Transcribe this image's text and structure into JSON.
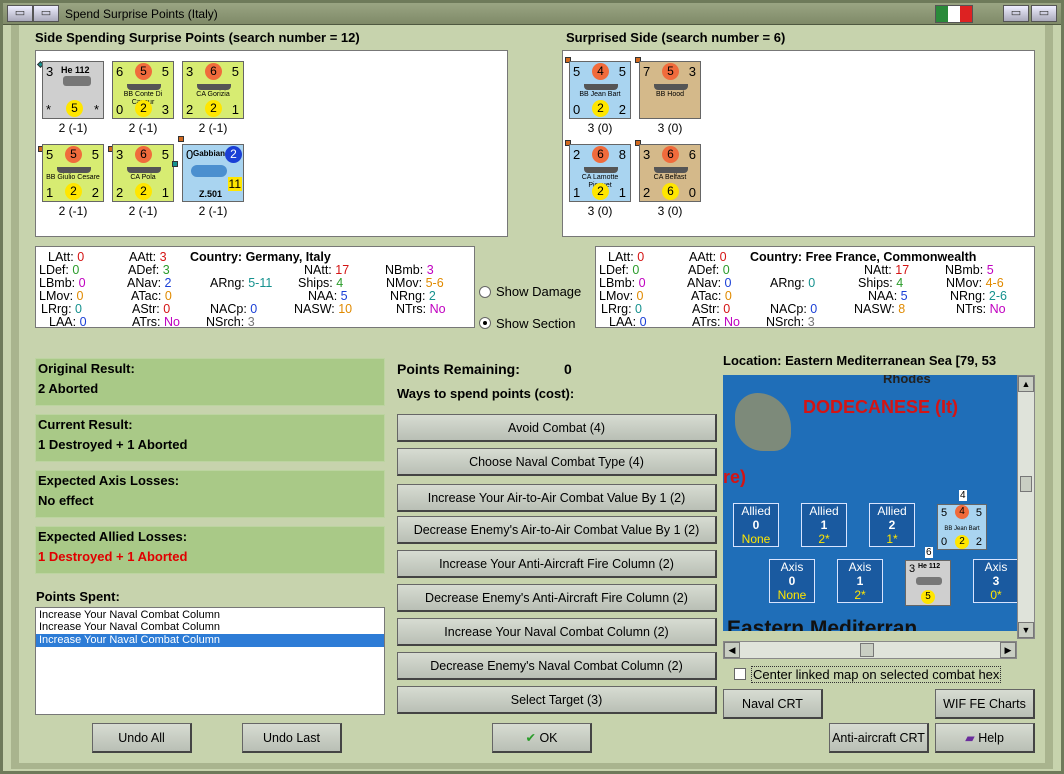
{
  "window": {
    "title": "Spend Surprise Points (Italy)"
  },
  "left_side": {
    "heading": "Side Spending Surprise Points (search number = 12)",
    "units": [
      {
        "name": "He 112",
        "tl": "3",
        "tr": "",
        "circle": "5",
        "bl": "*",
        "br": "*",
        "caption": "2 (-1)"
      },
      {
        "name": "BB Conte Di Cavour",
        "tl": "6",
        "tr": "5",
        "circle": "5",
        "bl": "0",
        "bm": "2",
        "br": "3",
        "caption": "2 (-1)"
      },
      {
        "name": "CA Gorizia",
        "tl": "3",
        "tr": "5",
        "circle": "6",
        "bl": "2",
        "bm": "2",
        "br": "1",
        "caption": "2 (-1)"
      },
      {
        "name": "BB Giulio Cesare",
        "tl": "5",
        "tr": "5",
        "circle": "5",
        "bl": "1",
        "bm": "2",
        "br": "2",
        "caption": "2 (-1)"
      },
      {
        "name": "CA Pola",
        "tl": "3",
        "tr": "5",
        "circle": "6",
        "bl": "2",
        "bm": "2",
        "br": "1",
        "caption": "2 (-1)"
      },
      {
        "name": "Gabbiano",
        "name2": "Z.501",
        "tl": "0",
        "circle": "2",
        "br": "11",
        "caption": "2 (-1)"
      }
    ]
  },
  "right_side": {
    "heading": "Surprised Side (search number = 6)",
    "units": [
      {
        "name": "BB Jean Bart",
        "tl": "5",
        "tr": "5",
        "circle": "4",
        "bl": "0",
        "bm": "2",
        "br": "2",
        "caption": "3 (0)"
      },
      {
        "name": "BB Hood",
        "tl": "7",
        "tr": "3",
        "circle": "5",
        "bl": "",
        "bm": "",
        "br": "",
        "caption": "3 (0)"
      },
      {
        "name": "CA Lamotte Picquet",
        "tl": "2",
        "tr": "8",
        "circle": "6",
        "bl": "1",
        "bm": "2",
        "br": "1",
        "caption": "3 (0)"
      },
      {
        "name": "CA Belfast",
        "tl": "3",
        "tr": "6",
        "circle": "6",
        "bl": "2",
        "bm": "6",
        "br": "0",
        "caption": "3 (0)"
      }
    ]
  },
  "left_stats": {
    "country_label": "Country:",
    "country": "Germany, Italy",
    "LAtt": "0",
    "LDef": "0",
    "LBmb": "0",
    "LMov": "0",
    "LRrg": "0",
    "LAA": "0",
    "AAtt": "3",
    "ADef": "3",
    "ANav": "2",
    "ATac": "0",
    "AStr": "0",
    "ATrs": "No",
    "ARng": "5-11",
    "NACp": "0",
    "NSrch": "3",
    "NAtt": "17",
    "Ships": "4",
    "NAA": "5",
    "NASW": "10",
    "NBmb": "3",
    "NMov": "5-6",
    "NRng": "2",
    "NTrs": "No"
  },
  "right_stats": {
    "country_label": "Country:",
    "country": "Free France, Commonwealth",
    "LAtt": "0",
    "LDef": "0",
    "LBmb": "0",
    "LMov": "0",
    "LRrg": "0",
    "LAA": "0",
    "AAtt": "0",
    "ADef": "0",
    "ANav": "0",
    "ATac": "0",
    "AStr": "0",
    "ATrs": "No",
    "ARng": "0",
    "NACp": "0",
    "NSrch": "3",
    "NAtt": "17",
    "Ships": "4",
    "NAA": "5",
    "NASW": "8",
    "NBmb": "5",
    "NMov": "4-6",
    "NRng": "2-6",
    "NTrs": "No"
  },
  "options": {
    "show_damage": "Show Damage",
    "show_section": "Show Section"
  },
  "results": {
    "original_label": "Original Result:",
    "original_value": "2 Aborted",
    "current_label": "Current Result:",
    "current_value": "1 Destroyed + 1 Aborted",
    "axis_label": "Expected Axis Losses:",
    "axis_value": "No effect",
    "allied_label": "Expected Allied Losses:",
    "allied_value": "1 Destroyed + 1 Aborted"
  },
  "points_spent": {
    "label": "Points Spent:",
    "items": [
      "Increase Your Naval Combat Column",
      "Increase Your Naval Combat Column",
      "Increase Your Naval Combat Column"
    ]
  },
  "spend": {
    "remaining_label": "Points Remaining:",
    "remaining_value": "0",
    "ways_label": "Ways to spend points (cost):",
    "buttons": [
      "Avoid Combat (4)",
      "Choose Naval Combat Type (4)",
      "Increase Your Air-to-Air Combat Value By 1 (2)",
      "Decrease Enemy's Air-to-Air Combat Value By 1 (2)",
      "Increase Your Anti-Aircraft Fire Column (2)",
      "Decrease Enemy's Anti-Aircraft Fire Column (2)",
      "Increase Your Naval Combat Column (2)",
      "Decrease Enemy's Naval Combat Column (2)",
      "Select Target (3)"
    ]
  },
  "map": {
    "location": "Location: Eastern Mediterranean Sea [79, 53",
    "rhodes": "Rhodes",
    "dodecanese": "DODECANESE (It)",
    "re": "re)",
    "sea": "Eastern Mediterran",
    "allied": [
      {
        "t": "Allied",
        "n": "0",
        "s": "None"
      },
      {
        "t": "Allied",
        "n": "1",
        "s": "2*"
      },
      {
        "t": "Allied",
        "n": "2",
        "s": "1*"
      }
    ],
    "axis": [
      {
        "t": "Axis",
        "n": "0",
        "s": "None"
      },
      {
        "t": "Axis",
        "n": "1",
        "s": "2*"
      },
      {
        "t": "Axis",
        "n": "3",
        "s": "0*"
      }
    ],
    "stack_top": "4",
    "stack_bottom": "6",
    "map_unit1": {
      "name": "BB Jean Bart",
      "tl": "5",
      "circle": "4",
      "tr": "5",
      "bl": "0",
      "bm": "2",
      "br": "2"
    },
    "map_unit2": {
      "name": "He 112",
      "tl": "3",
      "circle": "5"
    }
  },
  "center_linked": "Center linked map on selected combat hex",
  "buttons": {
    "naval_crt": "Naval CRT",
    "wif_charts": "WIF FE Charts",
    "undo_all": "Undo All",
    "undo_last": "Undo Last",
    "ok": "OK",
    "aa_crt": "Anti-aircraft CRT",
    "help": "Help"
  },
  "colors": {
    "green_panel": "#a9c987",
    "window_bg": "#c7d3ad",
    "italy_unit": "#d7ec72",
    "ff_unit": "#a9d4f0",
    "cw_unit": "#d4b98a",
    "selected": "#2d7cd6"
  }
}
